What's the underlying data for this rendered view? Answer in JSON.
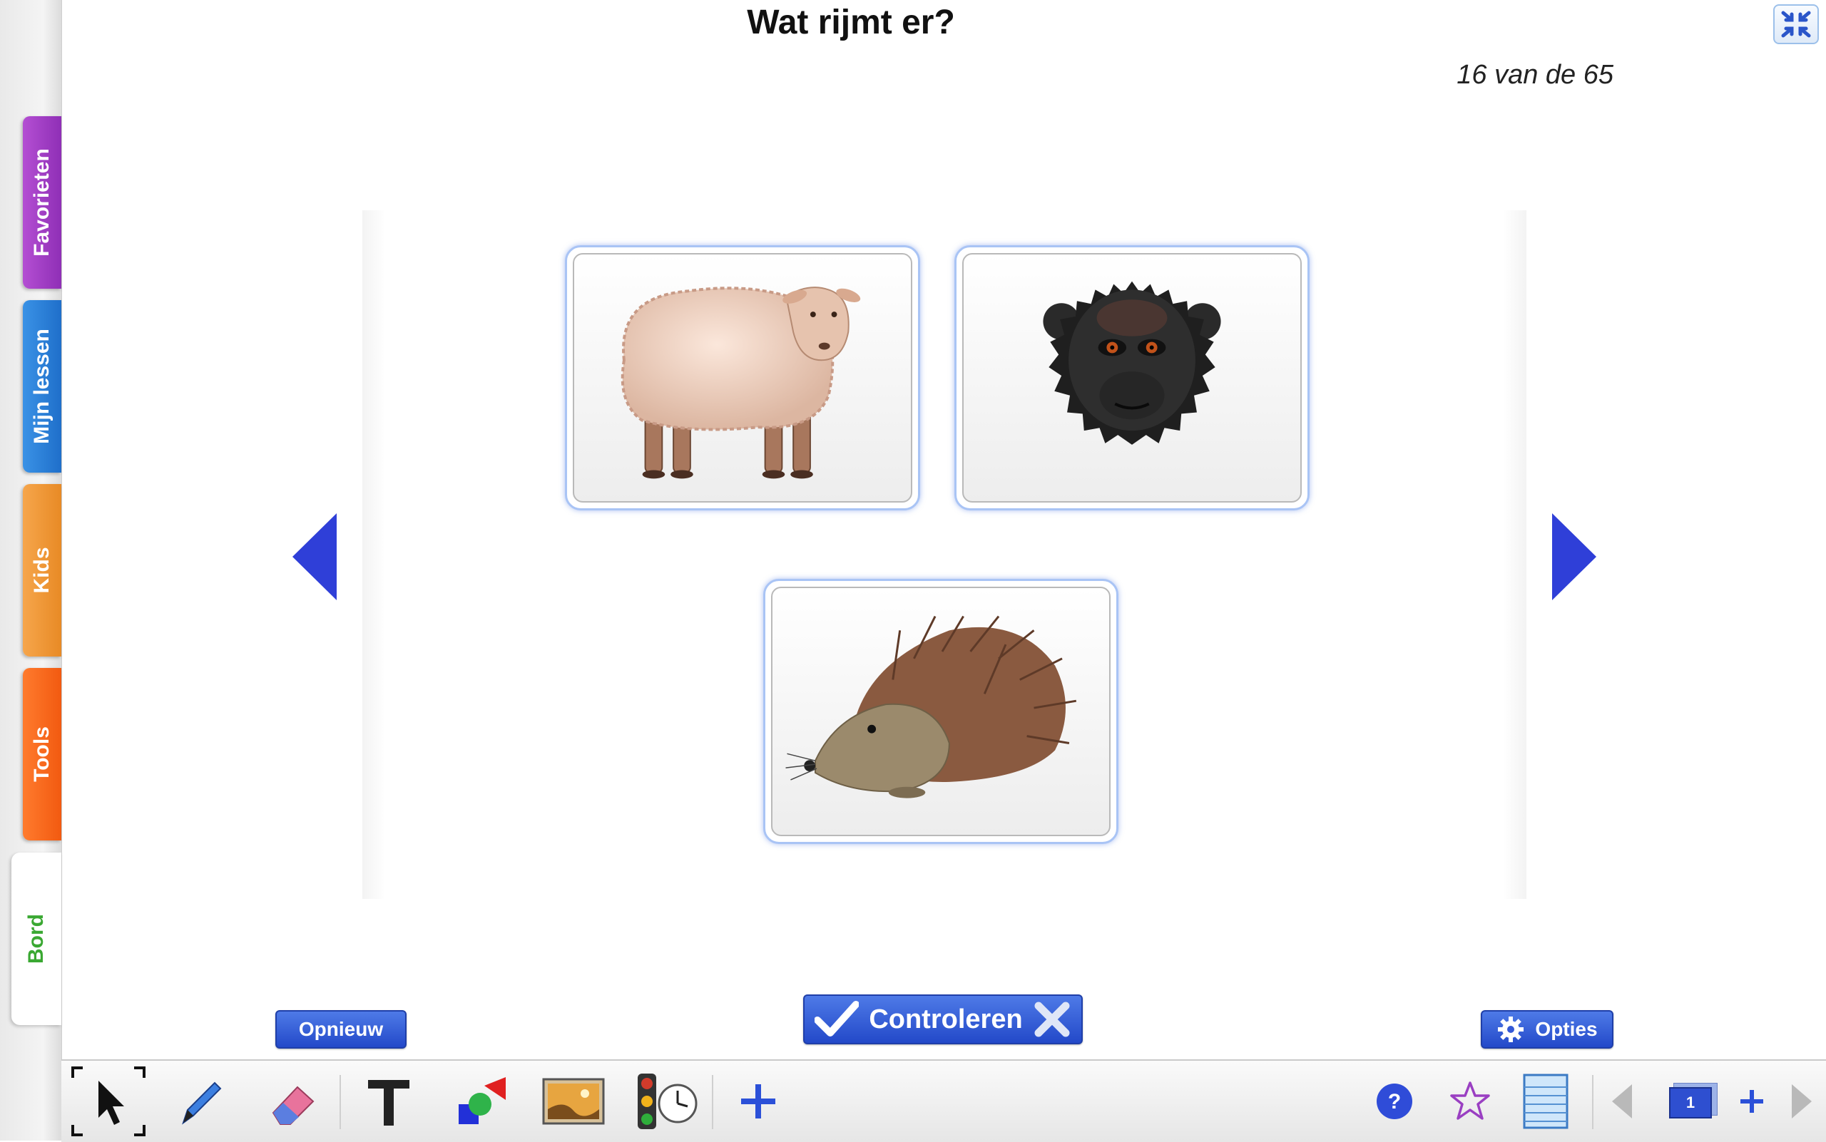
{
  "sidebar": {
    "tabs": [
      {
        "label": "Favorieten"
      },
      {
        "label": "Mijn lessen"
      },
      {
        "label": "Kids"
      },
      {
        "label": "Tools"
      },
      {
        "label": "Bord"
      }
    ]
  },
  "header": {
    "title": "Wat rijmt er?",
    "counter": "16 van de 65"
  },
  "cards": [
    {
      "icon": "sheep"
    },
    {
      "icon": "monkey"
    },
    {
      "icon": "hedgehog"
    }
  ],
  "buttons": {
    "opnieuw": "Opnieuw",
    "controleren": "Controleren",
    "opties": "Opties"
  },
  "toolbar": {
    "page_number": "1"
  },
  "colors": {
    "accent": "#2b50d8",
    "bord_label": "#3aa832"
  }
}
